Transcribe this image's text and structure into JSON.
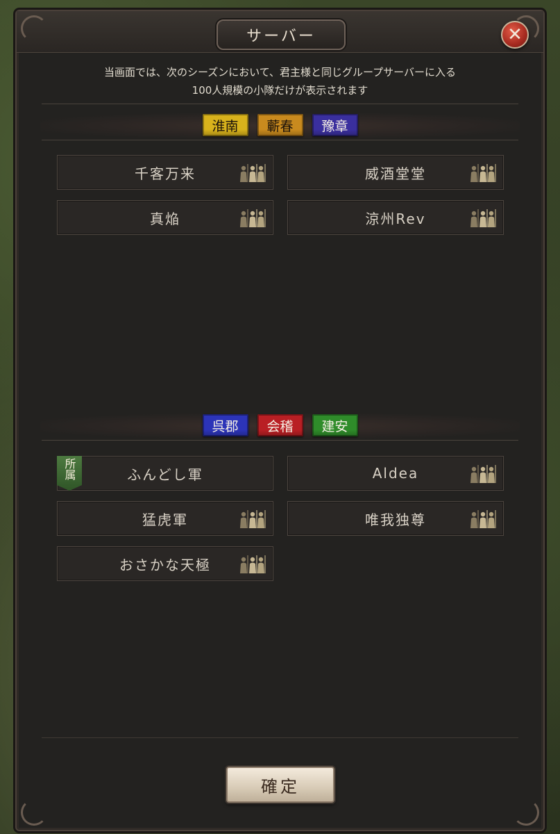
{
  "dialog": {
    "title": "サーバー",
    "close_label": "✕",
    "notice_line1": "当画面では、次のシーズンにおいて、君主様と同じグループサーバーに入る",
    "notice_line2": "100人規模の小隊だけが表示されます",
    "confirm_label": "確定"
  },
  "groups": [
    {
      "flags": [
        {
          "label": "淮南",
          "color": "#d8b21c",
          "ink_dark": true
        },
        {
          "label": "蘄春",
          "color": "#c98a1e",
          "ink_dark": true
        },
        {
          "label": "豫章",
          "color": "#3a2f9e",
          "ink_dark": false
        }
      ],
      "squads": [
        {
          "name": "千客万来",
          "icon": "soldiers-icon"
        },
        {
          "name": "威酒堂堂",
          "icon": "soldiers-icon"
        },
        {
          "name": "真焔",
          "icon": "soldiers-icon"
        },
        {
          "name": "涼州Rev",
          "icon": "soldiers-icon"
        }
      ]
    },
    {
      "flags": [
        {
          "label": "呉郡",
          "color": "#2c34b8",
          "ink_dark": false
        },
        {
          "label": "会稽",
          "color": "#b91f24",
          "ink_dark": false
        },
        {
          "label": "建安",
          "color": "#2f8c2a",
          "ink_dark": false
        }
      ],
      "squads": [
        {
          "name": "ふんどし軍",
          "badge": "所属"
        },
        {
          "name": "Aldea",
          "icon": "soldiers-icon"
        },
        {
          "name": "猛虎軍",
          "icon": "soldiers-icon"
        },
        {
          "name": "唯我独尊",
          "icon": "soldiers-icon"
        },
        {
          "name": "おさかな天極",
          "icon": "soldiers-icon"
        }
      ]
    }
  ],
  "colors": {
    "panel_bg": "#232220",
    "card_bg": "#2a2725",
    "affiliation_badge": "#3f6a33",
    "close_button": "#b8321f"
  }
}
